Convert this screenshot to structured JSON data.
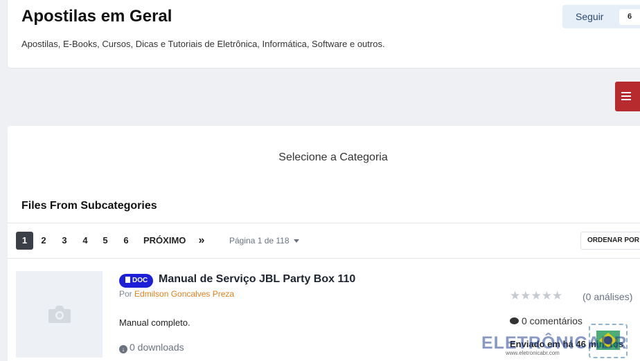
{
  "header": {
    "title": "Apostilas em Geral",
    "description": "Apostilas, E-Books, Cursos, Dicas e Tutoriais de Eletrônica, Informática, Software e outros.",
    "follow_label": "Seguir",
    "follow_count": "6"
  },
  "main": {
    "select_category": "Selecione a Categoria",
    "section_title": "Files From Subcategories"
  },
  "pagination": {
    "pages": [
      "1",
      "2",
      "3",
      "4",
      "5",
      "6"
    ],
    "active_page": "1",
    "next_label": "PRÓXIMO",
    "last_label": "»",
    "page_info": "Página 1 de 118",
    "sort_label": "ORDENAR POR"
  },
  "file": {
    "badge": "DOC",
    "title": "Manual de Serviço JBL Party Box 110",
    "author_prefix": "Por",
    "author": "Edmilson Goncalves Preza",
    "description": "Manual completo.",
    "downloads": "0 downloads",
    "stars": "★★★★★",
    "rating_count": "0",
    "reviews": "(0 análises)",
    "comments": "0 comentários",
    "submitted": "Enviado em há 46 minutos"
  },
  "watermark": {
    "text": "ELETRÔNICABR",
    "url": "www.eletronicabr.com"
  },
  "colors": {
    "accent_red": "#b72a2e",
    "badge_blue": "#1d20d6",
    "author_orange": "#e5801c"
  }
}
